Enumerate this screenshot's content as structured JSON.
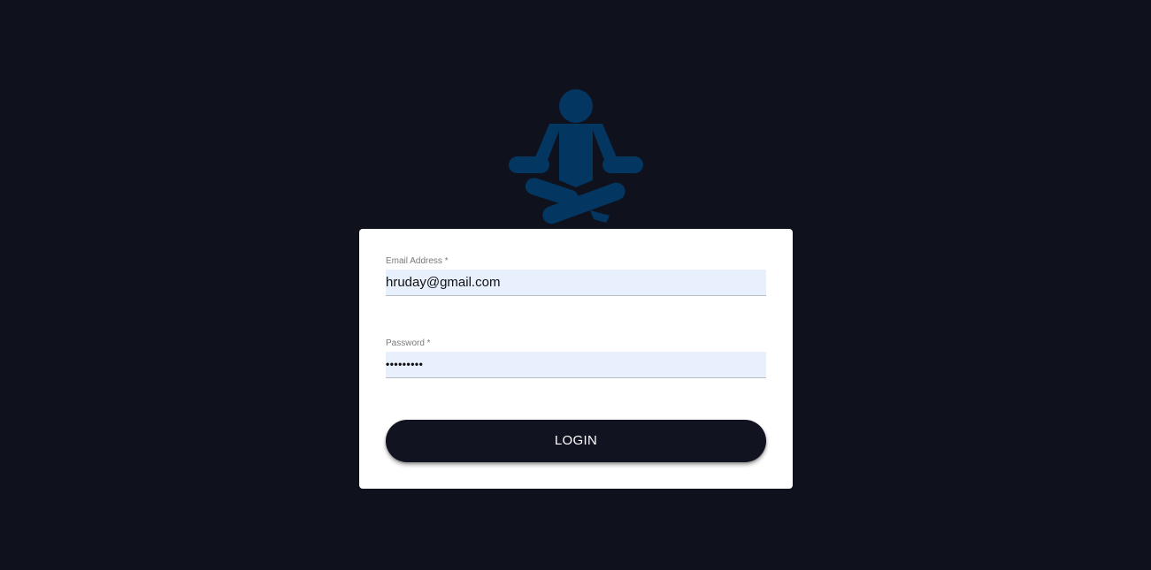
{
  "logo": {
    "icon": "meditation-person-icon",
    "color": "#033661"
  },
  "form": {
    "email": {
      "label": "Email Address *",
      "value": "hruday@gmail.com"
    },
    "password": {
      "label": "Password *",
      "value": "•••••••••"
    },
    "submit_label": "LOGIN"
  },
  "colors": {
    "background": "#0f111c",
    "card": "#ffffff",
    "input_fill": "#e8f0fe",
    "button": "#111320",
    "logo": "#033661"
  }
}
